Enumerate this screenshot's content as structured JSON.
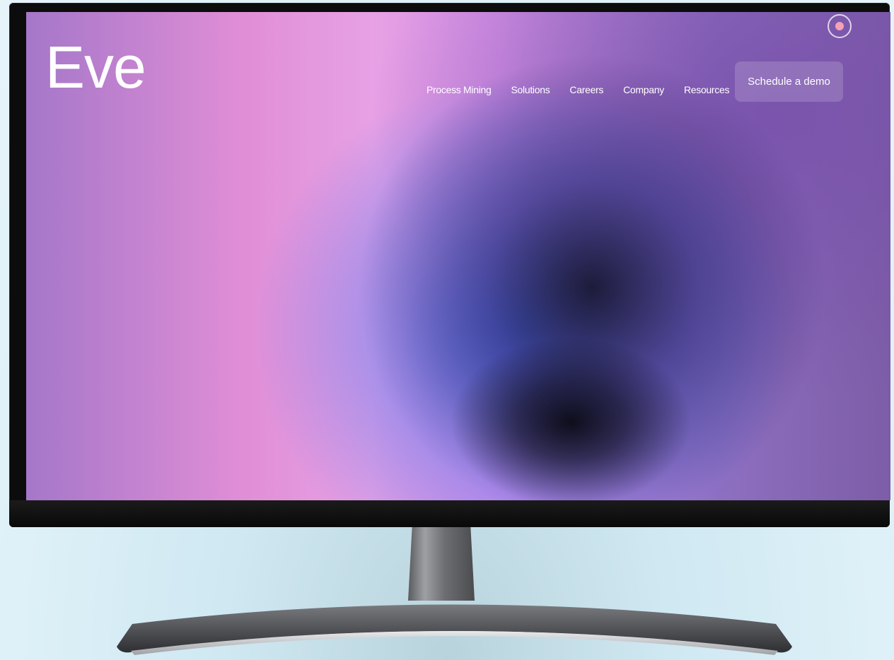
{
  "site": {
    "logo": "Eve",
    "nav": [
      "Process Mining",
      "Solutions",
      "Careers",
      "Company",
      "Resources"
    ],
    "cta": "Schedule a demo"
  },
  "colors": {
    "accent_dot": "#f4a0b8",
    "text": "#ffffff"
  }
}
